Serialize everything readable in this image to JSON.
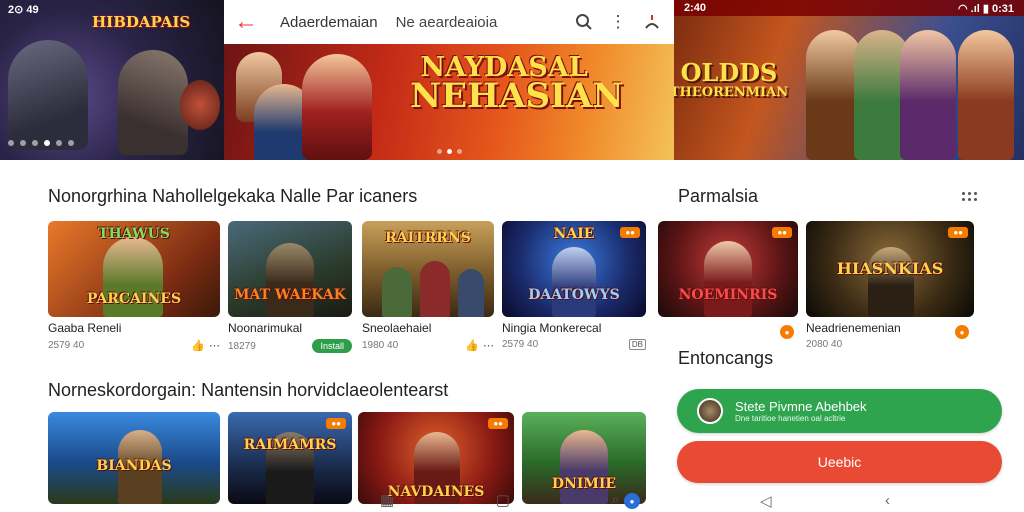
{
  "left_banner": {
    "status": "2⊙ 49",
    "title": "HIBDAPAIS"
  },
  "topbar": {
    "back_icon": "←",
    "title": "Adaerdemaian",
    "subtitle": "Ne aeardeaioia"
  },
  "hero": {
    "title_line1": "NAYDASAL",
    "title_line2": "NEHASIAN"
  },
  "right_banner": {
    "status_time": "2:40",
    "status_icons": "◠ .ıl ▮ 0:31",
    "title_line1": "OLDDS",
    "title_line2": "THEORENMIAN"
  },
  "section1": {
    "title": "Nonorgrhina Nahollelgekaka Nalle Par icaners",
    "cards": [
      {
        "thumb": "PARCAINES",
        "top": "THAWUS",
        "name": "Gaaba Reneli",
        "meta": "2579 40"
      },
      {
        "thumb": "MAT WAEKAK",
        "name": "Noonarimukal",
        "meta": "18279",
        "install": "Install"
      },
      {
        "thumb": "RAITRRNS",
        "name": "Sneolaehaiel",
        "meta": "1980 40"
      },
      {
        "thumb": "DAATOWYS",
        "top": "NAIE",
        "name": "Ningia Monkerecal",
        "meta": "2579 40",
        "box": "DB"
      }
    ]
  },
  "section_right": {
    "title": "Parmalsia",
    "cards": [
      {
        "thumb": "NOEMINRIS",
        "name": ""
      },
      {
        "thumb": "HIASNKIAS",
        "name": "Neadrienemenian",
        "meta": "2080 40"
      }
    ],
    "subtitle": "Entoncangs"
  },
  "section2": {
    "title": "Norneskordorgain: Nantensin horvidclaeolentearst",
    "cards": [
      {
        "thumb": "BIANDAS"
      },
      {
        "thumb": "RAIMAMRS"
      },
      {
        "thumb": "NAVDAINES"
      },
      {
        "thumb": "DNIMIE"
      }
    ]
  },
  "buttons": {
    "green_title": "Stete Pivmne Abehbek",
    "green_sub": "Dne taritioe hanetien oal acltrie",
    "red_label": "Ueebic"
  },
  "colors": {
    "accent_red": "#e84a33",
    "accent_green": "#2ea44f",
    "badge_orange": "#f57c00"
  }
}
